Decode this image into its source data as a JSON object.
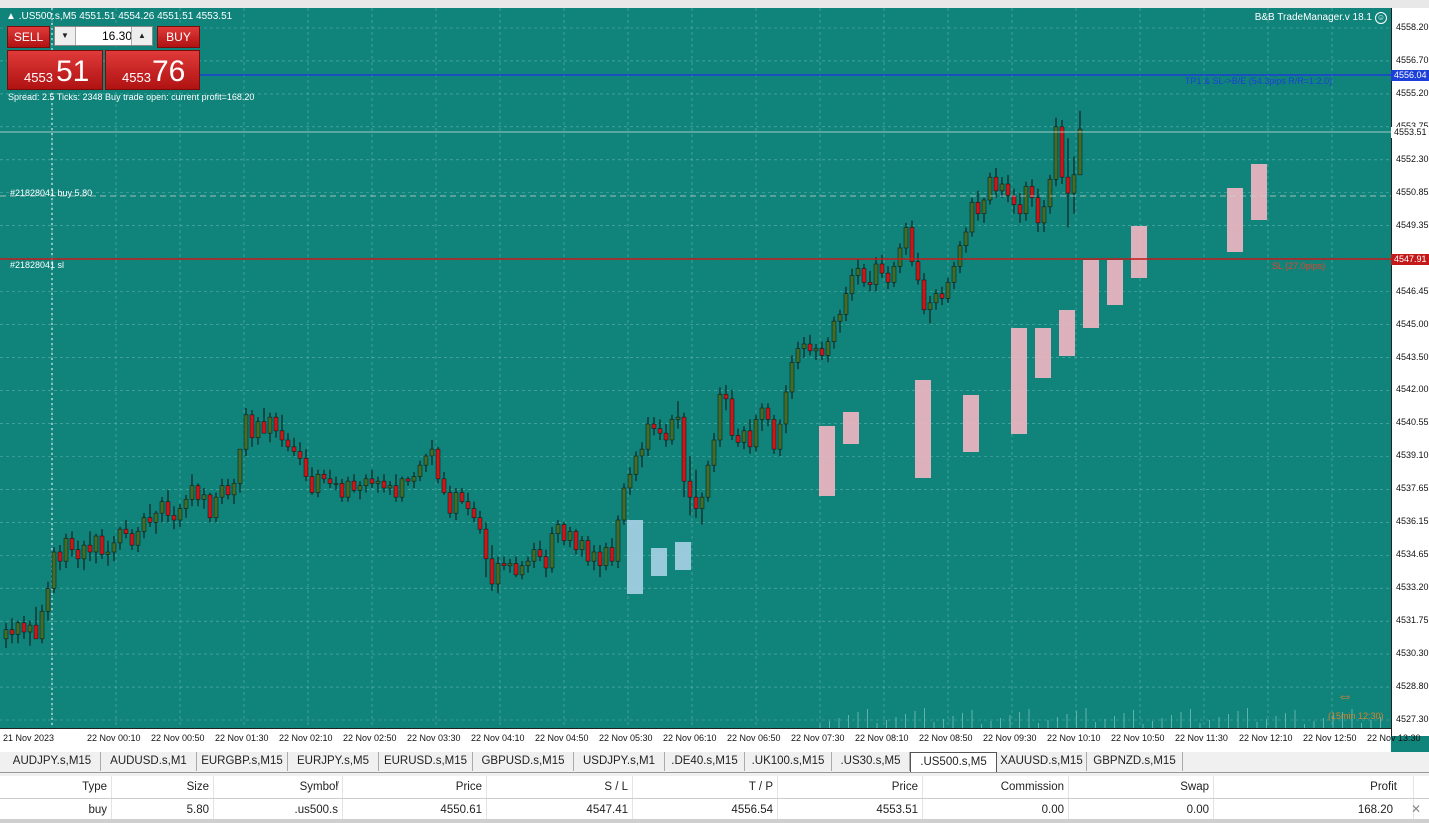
{
  "chart": {
    "symbol_title": ".US500.s,M5  4551.51 4554.26 4551.51 4553.51",
    "ea_name": "B&B TradeManager.v 18.1",
    "ea_icon": "smiley-icon",
    "background": "#10837b",
    "bull_color": "#3c6e2e",
    "bear_color": "#c41a1a",
    "info_line": "Spread: 2.5   Ticks: 2348   Buy trade open: current profit=168.20",
    "order_label_buy": "#21828041 buy 5.80",
    "order_label_sl": "#21828041 sl",
    "tp_text": "TP1 & SL->B/E (54.3pips R/R=1:2.0)",
    "sl_text": "SL (27.0pips)",
    "timer_text": "(15min 12:30)",
    "timer_icon": "double-arrow-icon",
    "tp_price": "4556.04",
    "sl_price": "4547.91",
    "current_price": "4553.51",
    "price_ticks": [
      "4558.20",
      "4556.70",
      "4555.20",
      "4553.75",
      "4552.30",
      "4550.85",
      "4549.35",
      "4547.90",
      "4546.45",
      "4545.00",
      "4543.50",
      "4542.00",
      "4540.55",
      "4539.10",
      "4537.65",
      "4536.15",
      "4534.65",
      "4533.20",
      "4531.75",
      "4530.30",
      "4528.80",
      "4527.30"
    ],
    "time_ticks": [
      "21 Nov 2023",
      "22 Nov 00:10",
      "22 Nov 00:50",
      "22 Nov 01:30",
      "22 Nov 02:10",
      "22 Nov 02:50",
      "22 Nov 03:30",
      "22 Nov 04:10",
      "22 Nov 04:50",
      "22 Nov 05:30",
      "22 Nov 06:10",
      "22 Nov 06:50",
      "22 Nov 07:30",
      "22 Nov 08:10",
      "22 Nov 08:50",
      "22 Nov 09:30",
      "22 Nov 10:10",
      "22 Nov 10:50",
      "22 Nov 11:30",
      "22 Nov 12:10",
      "22 Nov 12:50",
      "22 Nov 13:30"
    ]
  },
  "trading_panel": {
    "sell_label": "SELL",
    "buy_label": "BUY",
    "lot_value": "16.30",
    "sell_small": "4553",
    "sell_big": "51",
    "buy_small": "4553",
    "buy_big": "76"
  },
  "tabs": [
    "AUDJPY.s,M15",
    "AUDUSD.s,M1",
    "EURGBP.s,M15",
    "EURJPY.s,M5",
    "EURUSD.s,M15",
    "GBPUSD.s,M15",
    "USDJPY.s,M1",
    ".DE40.s,M15",
    ".UK100.s,M15",
    ".US30.s,M5",
    ".US500.s,M5",
    "XAUUSD.s,M15",
    "GBPNZD.s,M15"
  ],
  "active_tab": ".US500.s,M5",
  "trade_table": {
    "headers": [
      "Type",
      "Size",
      "Symbol",
      "Price",
      "S / L",
      "T / P",
      "Price",
      "Commission",
      "Swap",
      "Profit"
    ],
    "symbol_sort": "/",
    "row": [
      "buy",
      "5.80",
      ".us500.s",
      "4550.61",
      "4547.41",
      "4556.54",
      "4553.51",
      "0.00",
      "0.00",
      "168.20"
    ],
    "close_icon": "close-icon"
  },
  "chart_data": {
    "type": "candlestick",
    "ylim": [
      4527.3,
      4558.8
    ],
    "candles": [
      [
        4531.2,
        4531.9,
        4530.8,
        4531.6
      ],
      [
        4531.6,
        4532.1,
        4531.0,
        4531.4
      ],
      [
        4531.4,
        4532.0,
        4531.0,
        4531.9
      ],
      [
        4531.9,
        4532.2,
        4531.2,
        4531.5
      ],
      [
        4531.5,
        4532.0,
        4530.9,
        4531.8
      ],
      [
        4531.8,
        4532.6,
        4531.3,
        4531.2
      ],
      [
        4531.2,
        4532.7,
        4531.0,
        4532.4
      ],
      [
        4532.4,
        4533.7,
        4532.0,
        4533.4
      ],
      [
        4533.4,
        4535.2,
        4533.2,
        4535.0
      ],
      [
        4535.0,
        4535.3,
        4534.2,
        4534.6
      ],
      [
        4534.6,
        4535.8,
        4534.3,
        4535.6
      ],
      [
        4535.6,
        4535.9,
        4534.8,
        4535.1
      ],
      [
        4535.1,
        4535.5,
        4534.3,
        4534.7
      ],
      [
        4534.7,
        4535.5,
        4534.2,
        4535.3
      ],
      [
        4535.3,
        4535.9,
        4534.6,
        4535.0
      ],
      [
        4535.0,
        4535.8,
        4534.5,
        4535.7
      ],
      [
        4535.7,
        4536.0,
        4534.7,
        4534.9
      ],
      [
        4534.9,
        4535.5,
        4534.4,
        4535.0
      ],
      [
        4535.0,
        4535.7,
        4534.6,
        4535.4
      ],
      [
        4535.4,
        4536.1,
        4535.1,
        4536.0
      ],
      [
        4536.0,
        4536.4,
        4535.6,
        4535.8
      ],
      [
        4535.8,
        4536.0,
        4535.1,
        4535.3
      ],
      [
        4535.3,
        4536.1,
        4535.0,
        4535.9
      ],
      [
        4535.9,
        4536.7,
        4535.6,
        4536.5
      ],
      [
        4536.5,
        4537.1,
        4536.1,
        4536.3
      ],
      [
        4536.3,
        4536.8,
        4535.8,
        4536.7
      ],
      [
        4536.7,
        4537.4,
        4536.3,
        4537.2
      ],
      [
        4537.2,
        4537.7,
        4536.3,
        4536.6
      ],
      [
        4536.6,
        4537.0,
        4536.0,
        4536.4
      ],
      [
        4536.4,
        4537.1,
        4536.1,
        4536.9
      ],
      [
        4536.9,
        4537.5,
        4536.5,
        4537.3
      ],
      [
        4537.3,
        4538.4,
        4537.0,
        4537.9
      ],
      [
        4537.9,
        4538.0,
        4537.0,
        4537.3
      ],
      [
        4537.3,
        4537.8,
        4536.9,
        4537.5
      ],
      [
        4537.5,
        4537.6,
        4536.3,
        4536.5
      ],
      [
        4536.5,
        4537.6,
        4536.3,
        4537.4
      ],
      [
        4537.4,
        4538.2,
        4537.1,
        4537.9
      ],
      [
        4537.9,
        4538.2,
        4537.3,
        4537.5
      ],
      [
        4537.5,
        4538.2,
        4537.1,
        4538.0
      ],
      [
        4538.0,
        4539.4,
        4537.6,
        4539.5
      ],
      [
        4539.5,
        4541.3,
        4539.2,
        4541.0
      ],
      [
        4541.0,
        4541.2,
        4539.6,
        4540.0
      ],
      [
        4540.0,
        4540.9,
        4539.7,
        4540.7
      ],
      [
        4540.7,
        4541.3,
        4540.2,
        4540.2
      ],
      [
        4540.2,
        4541.1,
        4539.8,
        4540.9
      ],
      [
        4540.9,
        4541.1,
        4540.0,
        4540.3
      ],
      [
        4540.3,
        4541.0,
        4539.6,
        4539.9
      ],
      [
        4539.9,
        4540.2,
        4539.4,
        4539.6
      ],
      [
        4539.6,
        4540.0,
        4539.2,
        4539.4
      ],
      [
        4539.4,
        4539.8,
        4538.8,
        4539.1
      ],
      [
        4539.1,
        4539.5,
        4538.1,
        4538.3
      ],
      [
        4538.3,
        4538.7,
        4537.5,
        4537.6
      ],
      [
        4537.6,
        4538.6,
        4537.4,
        4538.4
      ],
      [
        4538.4,
        4538.6,
        4538.0,
        4538.2
      ],
      [
        4538.2,
        4538.6,
        4537.8,
        4538.0
      ],
      [
        4538.0,
        4538.3,
        4537.7,
        4538.0
      ],
      [
        4538.0,
        4538.2,
        4537.2,
        4537.4
      ],
      [
        4537.4,
        4538.3,
        4537.2,
        4538.1
      ],
      [
        4538.1,
        4538.4,
        4537.6,
        4537.7
      ],
      [
        4537.7,
        4538.1,
        4537.3,
        4537.9
      ],
      [
        4537.9,
        4538.4,
        4537.6,
        4538.2
      ],
      [
        4538.2,
        4538.6,
        4537.8,
        4538.0
      ],
      [
        4538.0,
        4538.3,
        4537.6,
        4538.1
      ],
      [
        4538.1,
        4538.4,
        4537.6,
        4537.8
      ],
      [
        4537.8,
        4538.1,
        4537.5,
        4537.9
      ],
      [
        4537.9,
        4538.4,
        4537.2,
        4537.4
      ],
      [
        4537.4,
        4538.3,
        4537.2,
        4538.2
      ],
      [
        4538.2,
        4538.3,
        4537.9,
        4538.1
      ],
      [
        4538.1,
        4538.5,
        4537.8,
        4538.3
      ],
      [
        4538.3,
        4539.0,
        4538.1,
        4538.8
      ],
      [
        4538.8,
        4539.3,
        4538.5,
        4539.2
      ],
      [
        4539.2,
        4539.9,
        4538.8,
        4539.5
      ],
      [
        4539.5,
        4539.6,
        4538.0,
        4538.2
      ],
      [
        4538.2,
        4538.5,
        4537.5,
        4537.6
      ],
      [
        4537.6,
        4537.9,
        4536.5,
        4536.7
      ],
      [
        4536.7,
        4537.8,
        4536.4,
        4537.6
      ],
      [
        4537.6,
        4537.8,
        4537.1,
        4537.2
      ],
      [
        4537.2,
        4537.6,
        4536.6,
        4536.9
      ],
      [
        4536.9,
        4537.2,
        4536.3,
        4536.5
      ],
      [
        4536.5,
        4536.8,
        4535.8,
        4536.0
      ],
      [
        4536.0,
        4536.3,
        4533.9,
        4534.7
      ],
      [
        4534.7,
        4535.3,
        4533.3,
        4533.6
      ],
      [
        4533.6,
        4534.8,
        4533.2,
        4534.5
      ],
      [
        4534.5,
        4534.8,
        4534.2,
        4534.4
      ],
      [
        4534.4,
        4534.7,
        4534.1,
        4534.5
      ],
      [
        4534.5,
        4534.8,
        4533.9,
        4534.0
      ],
      [
        4534.0,
        4534.6,
        4533.8,
        4534.4
      ],
      [
        4534.4,
        4534.8,
        4534.1,
        4534.6
      ],
      [
        4534.6,
        4535.4,
        4534.3,
        4535.1
      ],
      [
        4535.1,
        4535.5,
        4534.6,
        4534.8
      ],
      [
        4534.8,
        4535.1,
        4533.9,
        4534.3
      ],
      [
        4534.3,
        4536.1,
        4534.1,
        4535.8
      ],
      [
        4535.8,
        4536.4,
        4535.4,
        4536.2
      ],
      [
        4536.2,
        4536.3,
        4535.3,
        4535.5
      ],
      [
        4535.5,
        4536.1,
        4535.2,
        4535.9
      ],
      [
        4535.9,
        4536.0,
        4534.9,
        4535.1
      ],
      [
        4535.1,
        4535.7,
        4534.8,
        4535.5
      ],
      [
        4535.5,
        4535.7,
        4534.4,
        4534.6
      ],
      [
        4534.6,
        4535.3,
        4534.2,
        4535.0
      ],
      [
        4535.0,
        4535.3,
        4533.9,
        4534.4
      ],
      [
        4534.4,
        4535.4,
        4534.2,
        4535.2
      ],
      [
        4535.2,
        4535.6,
        4534.4,
        4534.6
      ],
      [
        4534.6,
        4536.6,
        4534.3,
        4536.4
      ],
      [
        4536.4,
        4538.0,
        4536.2,
        4537.8
      ],
      [
        4537.8,
        4538.7,
        4537.5,
        4538.4
      ],
      [
        4538.4,
        4539.4,
        4538.1,
        4539.2
      ],
      [
        4539.2,
        4539.8,
        4538.7,
        4539.5
      ],
      [
        4539.5,
        4540.9,
        4539.2,
        4540.6
      ],
      [
        4540.6,
        4540.9,
        4540.1,
        4540.4
      ],
      [
        4540.4,
        4540.8,
        4539.9,
        4540.2
      ],
      [
        4540.2,
        4540.6,
        4539.6,
        4539.9
      ],
      [
        4539.9,
        4541.0,
        4539.7,
        4540.8
      ],
      [
        4540.8,
        4541.6,
        4540.4,
        4540.9
      ],
      [
        4540.9,
        4541.1,
        4537.4,
        4538.1
      ],
      [
        4538.1,
        4539.2,
        4536.6,
        4537.4
      ],
      [
        4537.4,
        4538.6,
        4536.5,
        4536.9
      ],
      [
        4536.9,
        4537.6,
        4536.2,
        4537.4
      ],
      [
        4537.4,
        4539.0,
        4537.2,
        4538.8
      ],
      [
        4538.8,
        4540.2,
        4538.5,
        4539.9
      ],
      [
        4539.9,
        4542.2,
        4539.6,
        4541.9
      ],
      [
        4541.9,
        4542.3,
        4541.2,
        4541.7
      ],
      [
        4541.7,
        4542.1,
        4539.9,
        4540.1
      ],
      [
        4540.1,
        4540.4,
        4539.6,
        4539.8
      ],
      [
        4539.8,
        4540.5,
        4539.5,
        4540.3
      ],
      [
        4540.3,
        4540.8,
        4539.3,
        4539.6
      ],
      [
        4539.6,
        4541.0,
        4539.4,
        4540.8
      ],
      [
        4540.8,
        4541.5,
        4540.3,
        4541.3
      ],
      [
        4541.3,
        4541.5,
        4540.5,
        4540.8
      ],
      [
        4540.8,
        4541.0,
        4539.3,
        4539.5
      ],
      [
        4539.5,
        4540.8,
        4539.2,
        4540.6
      ],
      [
        4540.6,
        4542.3,
        4540.2,
        4542.0
      ],
      [
        4542.0,
        4543.6,
        4541.7,
        4543.3
      ],
      [
        4543.3,
        4544.2,
        4543.0,
        4543.9
      ],
      [
        4543.9,
        4544.4,
        4543.5,
        4544.1
      ],
      [
        4544.1,
        4544.5,
        4543.6,
        4543.8
      ],
      [
        4543.8,
        4544.1,
        4543.4,
        4543.9
      ],
      [
        4543.9,
        4544.2,
        4543.4,
        4543.6
      ],
      [
        4543.6,
        4544.4,
        4543.3,
        4544.2
      ],
      [
        4544.2,
        4545.3,
        4543.9,
        4545.1
      ],
      [
        4545.1,
        4545.6,
        4544.6,
        4545.4
      ],
      [
        4545.4,
        4546.6,
        4545.1,
        4546.3
      ],
      [
        4546.3,
        4547.4,
        4546.0,
        4547.1
      ],
      [
        4547.1,
        4547.8,
        4546.7,
        4547.4
      ],
      [
        4547.4,
        4547.6,
        4546.6,
        4546.8
      ],
      [
        4546.8,
        4547.3,
        4546.4,
        4546.7
      ],
      [
        4546.7,
        4547.9,
        4546.4,
        4547.6
      ],
      [
        4547.6,
        4548.0,
        4547.0,
        4547.2
      ],
      [
        4547.2,
        4547.5,
        4546.5,
        4546.8
      ],
      [
        4546.8,
        4547.7,
        4546.6,
        4547.5
      ],
      [
        4547.5,
        4548.5,
        4547.2,
        4548.3
      ],
      [
        4548.3,
        4549.4,
        4548.0,
        4549.2
      ],
      [
        4549.2,
        4549.5,
        4547.5,
        4547.7
      ],
      [
        4547.7,
        4548.1,
        4546.7,
        4546.9
      ],
      [
        4546.9,
        4547.2,
        4545.4,
        4545.6
      ],
      [
        4545.6,
        4546.2,
        4545.0,
        4545.9
      ],
      [
        4545.9,
        4546.5,
        4545.6,
        4546.3
      ],
      [
        4546.3,
        4546.6,
        4545.8,
        4546.1
      ],
      [
        4546.1,
        4547.0,
        4545.9,
        4546.8
      ],
      [
        4546.8,
        4547.7,
        4546.5,
        4547.5
      ],
      [
        4547.5,
        4548.6,
        4547.2,
        4548.4
      ],
      [
        4548.4,
        4549.2,
        4548.1,
        4549.0
      ],
      [
        4549.0,
        4550.5,
        4548.8,
        4550.3
      ],
      [
        4550.3,
        4550.8,
        4549.5,
        4549.8
      ],
      [
        4549.8,
        4550.5,
        4549.4,
        4550.4
      ],
      [
        4550.4,
        4551.6,
        4550.2,
        4551.4
      ],
      [
        4551.4,
        4551.8,
        4550.5,
        4550.8
      ],
      [
        4550.8,
        4551.4,
        4550.5,
        4551.1
      ],
      [
        4551.1,
        4551.5,
        4550.3,
        4550.6
      ],
      [
        4550.6,
        4550.9,
        4549.8,
        4550.2
      ],
      [
        4550.2,
        4550.7,
        4549.4,
        4549.8
      ],
      [
        4549.8,
        4551.2,
        4549.5,
        4551.0
      ],
      [
        4551.0,
        4551.3,
        4550.1,
        4550.5
      ],
      [
        4550.5,
        4550.9,
        4549.0,
        4549.4
      ],
      [
        4549.4,
        4550.4,
        4549.0,
        4550.1
      ],
      [
        4550.1,
        4551.5,
        4549.8,
        4551.3
      ],
      [
        4551.3,
        4554.0,
        4551.0,
        4553.6
      ],
      [
        4553.6,
        4553.9,
        4551.1,
        4551.4
      ],
      [
        4551.4,
        4553.1,
        4549.2,
        4550.7
      ],
      [
        4550.7,
        4552.3,
        4549.8,
        4551.5
      ],
      [
        4551.5,
        4554.3,
        4551.5,
        4553.5
      ]
    ]
  }
}
